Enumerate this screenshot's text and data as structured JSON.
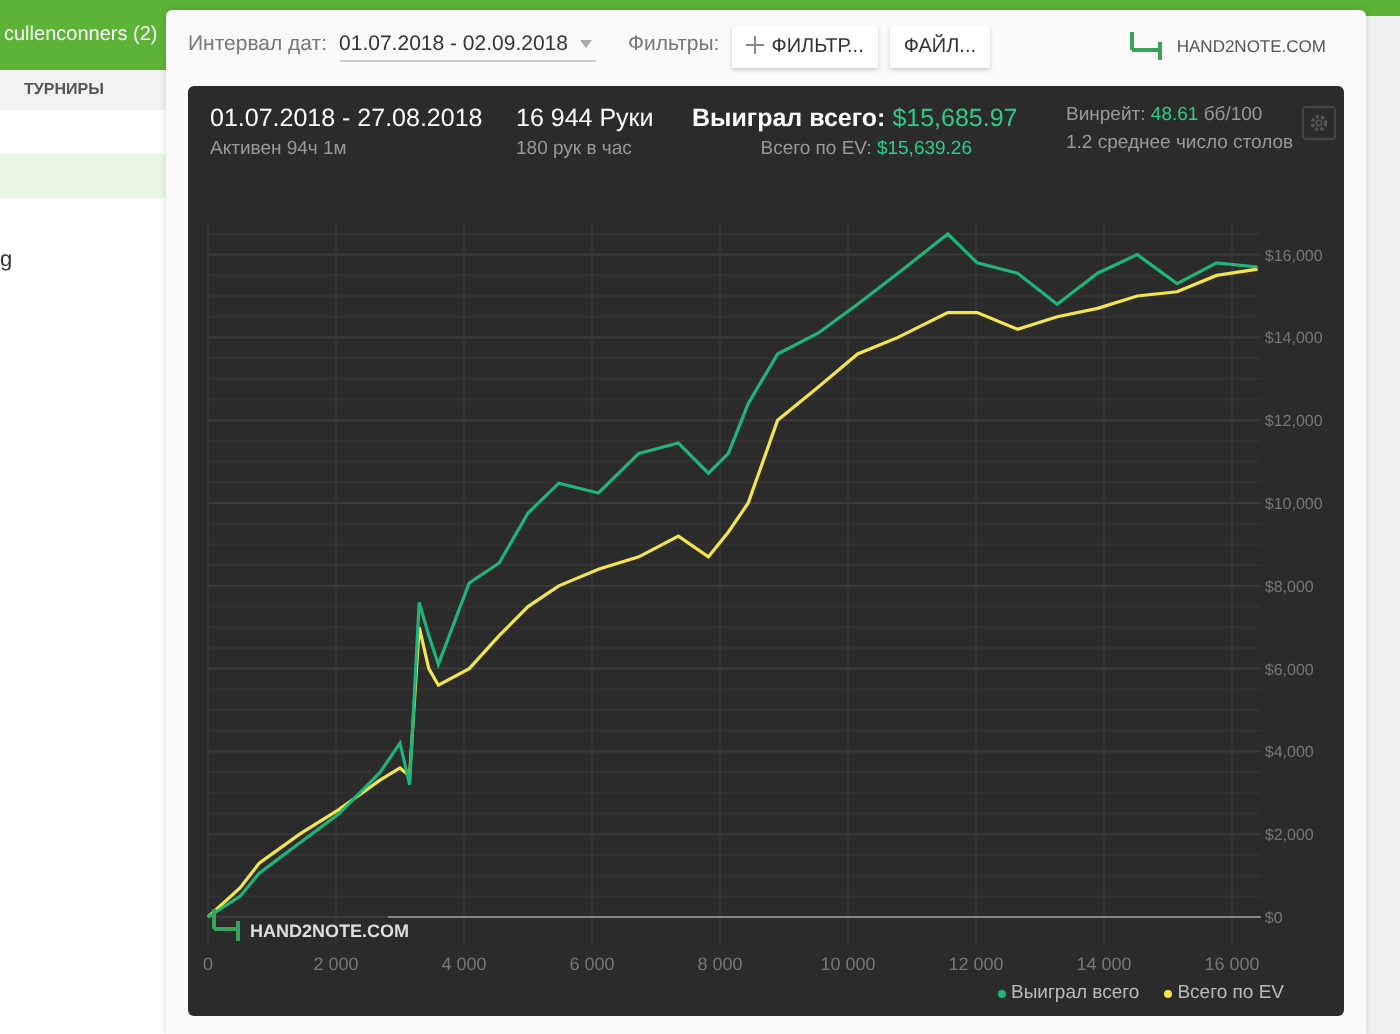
{
  "sidebar": {
    "account": "cullenconners (2)",
    "tab": "ТУРНИРЫ",
    "rows": [
      {
        "selected": true
      },
      {
        "label": "g",
        "selected": false
      }
    ]
  },
  "toolbar": {
    "date_label": "Интервал дат:",
    "date_range": "01.07.2018 - 02.09.2018",
    "filters_label": "Фильтры:",
    "buttons": [
      "ФИЛЬТР...",
      "ФАЙЛ..."
    ],
    "logo": "HAND2NOTE.COM"
  },
  "summary": {
    "period": "01.07.2018 - 27.08.2018",
    "active": "Активен 94ч 1м",
    "hands": "16 944 Руки",
    "hands_per_hour": "180 рук в час",
    "won_label": "Выиграл всего:",
    "won": "$15,685.97",
    "ev_label": "Всего по EV:",
    "ev": "$15,639.26",
    "winrate_label": "Винрейт:",
    "winrate": "48.61",
    "winrate_unit": "бб/100",
    "tables": "1.2 среднее число столов"
  },
  "chart_watermark": "HAND2NOTE.COM",
  "chart_data": {
    "type": "line",
    "x": [
      0,
      500,
      800,
      1430,
      2050,
      2680,
      3000,
      3150,
      3300,
      3450,
      3600,
      4080,
      4550,
      5000,
      5480,
      6100,
      6730,
      7350,
      7820,
      8130,
      8440,
      8900,
      9530,
      10150,
      10780,
      11560,
      12020,
      12650,
      13270,
      13900,
      14520,
      15140,
      15760,
      16400
    ],
    "series": [
      {
        "name": "Выиграл всего",
        "color": "#1fb57a",
        "values": [
          0,
          500,
          1060,
          1790,
          2500,
          3480,
          4200,
          3200,
          7600,
          6800,
          6100,
          8070,
          8550,
          9760,
          10480,
          10240,
          11200,
          11450,
          10720,
          11200,
          12400,
          13600,
          14100,
          14800,
          15550,
          16500,
          15800,
          15550,
          14800,
          15550,
          16000,
          15300,
          15800,
          15700
        ]
      },
      {
        "name": "Всего по EV",
        "color": "#f2e64a",
        "values": [
          0,
          700,
          1300,
          2000,
          2600,
          3300,
          3600,
          3400,
          7000,
          6000,
          5600,
          6000,
          6800,
          7500,
          8000,
          8400,
          8700,
          9200,
          8700,
          9300,
          10000,
          12000,
          12800,
          13600,
          14000,
          14600,
          14600,
          14200,
          14500,
          14700,
          15000,
          15100,
          15500,
          15650
        ]
      }
    ],
    "grid": true,
    "xlim": [
      0,
      16450
    ],
    "ylim": [
      -700,
      16800
    ],
    "xticks": [
      {
        "value": 0,
        "label": "0"
      },
      {
        "value": 2000,
        "label": "2 000"
      },
      {
        "value": 4000,
        "label": "4 000"
      },
      {
        "value": 6000,
        "label": "6 000"
      },
      {
        "value": 8000,
        "label": "8 000"
      },
      {
        "value": 10000,
        "label": "10 000"
      },
      {
        "value": 12000,
        "label": "12 000"
      },
      {
        "value": 14000,
        "label": "14 000"
      },
      {
        "value": 16000,
        "label": "16 000"
      }
    ],
    "yticks": [
      {
        "value": 0,
        "label": "$0"
      },
      {
        "value": 2000,
        "label": "$2,000"
      },
      {
        "value": 4000,
        "label": "$4,000"
      },
      {
        "value": 6000,
        "label": "$6,000"
      },
      {
        "value": 8000,
        "label": "$8,000"
      },
      {
        "value": 10000,
        "label": "$10,000"
      },
      {
        "value": 12000,
        "label": "$12,000"
      },
      {
        "value": 14000,
        "label": "$14,000"
      },
      {
        "value": 16000,
        "label": "$16,000"
      }
    ]
  }
}
